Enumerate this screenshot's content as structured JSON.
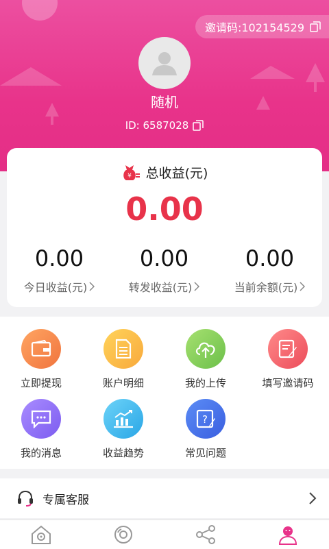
{
  "header": {
    "invite_text": "邀请码:102154529",
    "nickname": "随机",
    "user_id_text": "ID: 6587028"
  },
  "summary": {
    "title": "总收益(元)",
    "total": "0.00",
    "stats": [
      {
        "value": "0.00",
        "label": "今日收益(元)"
      },
      {
        "value": "0.00",
        "label": "转发收益(元)"
      },
      {
        "value": "0.00",
        "label": "当前余额(元)"
      }
    ]
  },
  "menu": {
    "items": [
      {
        "label": "立即提现",
        "icon": "wallet-icon"
      },
      {
        "label": "账户明细",
        "icon": "document-icon"
      },
      {
        "label": "我的上传",
        "icon": "cloud-upload-icon"
      },
      {
        "label": "填写邀请码",
        "icon": "edit-form-icon"
      },
      {
        "label": "我的消息",
        "icon": "message-icon"
      },
      {
        "label": "收益趋势",
        "icon": "trend-chart-icon"
      },
      {
        "label": "常见问题",
        "icon": "question-icon"
      }
    ]
  },
  "service": {
    "label": "专属客服"
  },
  "tabbar": {
    "tabs": [
      "home-icon",
      "disc-icon",
      "share-icon",
      "profile-icon"
    ],
    "active_index": 3
  },
  "colors": {
    "brand_pink": "#e8338a",
    "total_red": "#e8334a"
  }
}
